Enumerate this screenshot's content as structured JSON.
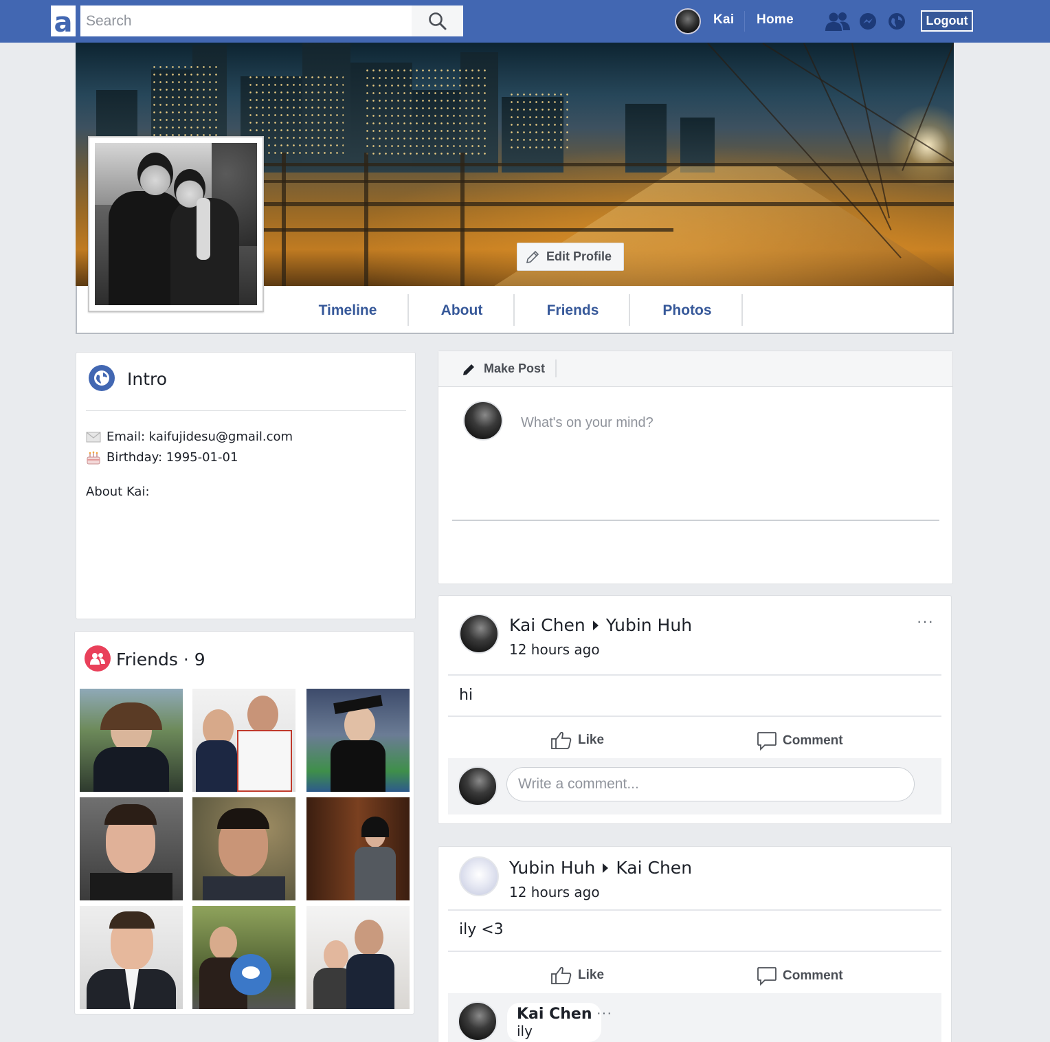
{
  "topbar": {
    "logo_letter": "a",
    "search_placeholder": "Search",
    "user_name": "Kai",
    "home_label": "Home",
    "logout_label": "Logout",
    "accent": "#4267b2"
  },
  "cover": {
    "edit_profile_label": "Edit Profile"
  },
  "tabs": [
    {
      "label": "Timeline"
    },
    {
      "label": "About"
    },
    {
      "label": "Friends"
    },
    {
      "label": "Photos"
    }
  ],
  "intro": {
    "title": "Intro",
    "email": "Email: kaifujidesu@gmail.com",
    "birthday": "Birthday: 1995-01-01",
    "about": "About Kai:"
  },
  "friends": {
    "title": "Friends · 9",
    "icon_color": "#e9405a"
  },
  "composer": {
    "header_label": "Make Post",
    "placeholder": "What's on your mind?"
  },
  "posts": [
    {
      "from": "Kai Chen",
      "to": "Yubin Huh",
      "time": "12 hours ago",
      "body": "hi",
      "like_label": "Like",
      "comment_label": "Comment",
      "comment_placeholder": "Write a comment..."
    },
    {
      "from": "Yubin Huh",
      "to": "Kai Chen",
      "time": "12 hours ago",
      "body": "ily <3",
      "like_label": "Like",
      "comment_label": "Comment",
      "comment": {
        "author": "Kai Chen",
        "text": "ily"
      }
    }
  ],
  "more_glyph": "···"
}
